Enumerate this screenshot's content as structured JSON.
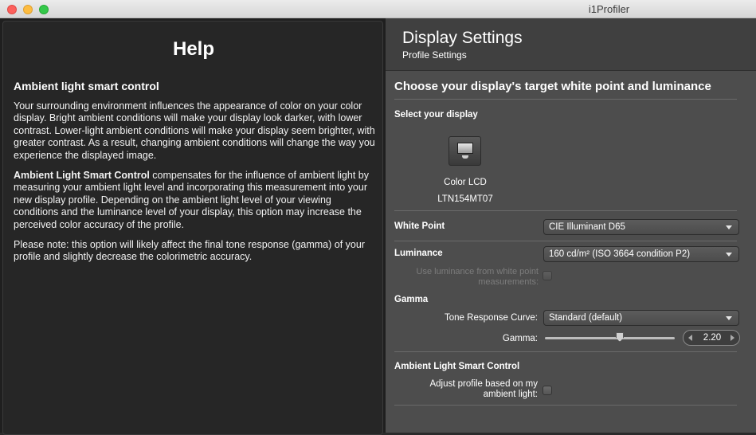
{
  "window": {
    "title": "i1Profiler"
  },
  "help": {
    "title": "Help",
    "subtitle": "Ambient light smart control",
    "para1": "Your surrounding environment influences the appearance of color on your color display. Bright ambient conditions will make your display look darker, with lower contrast. Lower-light ambient conditions will make your display seem brighter, with greater contrast. As a result, changing ambient conditions will change the way you experience the displayed image.",
    "para2_bold": "Ambient Light Smart Control",
    "para2_rest": " compensates for the influence of ambient light by measuring your ambient light level and incorporating this measurement into your new display profile. Depending on the ambient light level of your viewing conditions and the luminance level of your display, this option may increase the perceived color accuracy of the profile.",
    "para3": "Please note: this option will likely affect the final tone response (gamma) of your profile and slightly decrease the colorimetric accuracy."
  },
  "settings": {
    "header_title": "Display Settings",
    "header_sub": "Profile Settings",
    "section_title": "Choose your display's target white point and luminance",
    "select_display_label": "Select your display",
    "display_name": "Color LCD",
    "display_model": "LTN154MT07",
    "white_point_label": "White Point",
    "white_point_value": "CIE Illuminant D65",
    "luminance_label": "Luminance",
    "luminance_value": "160 cd/m² (ISO 3664 condition P2)",
    "use_luminance_label": "Use luminance from white point measurements:",
    "gamma_section": "Gamma",
    "trc_label": "Tone Response Curve:",
    "trc_value": "Standard (default)",
    "gamma_label": "Gamma:",
    "gamma_value": "2.20",
    "alsc_section": "Ambient Light Smart Control",
    "adjust_label": "Adjust profile based on my ambient light:"
  }
}
